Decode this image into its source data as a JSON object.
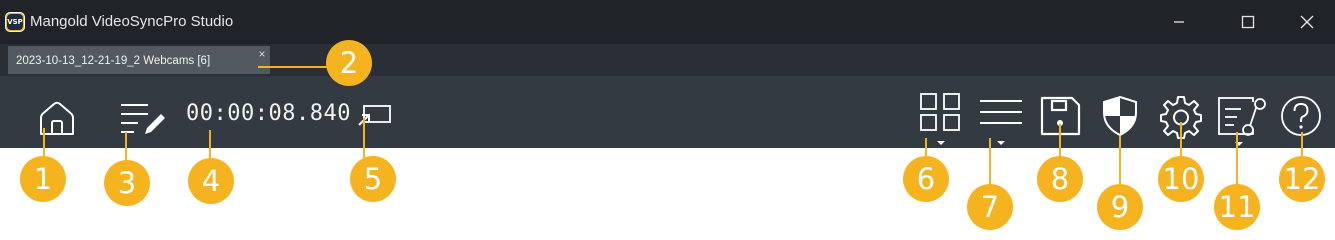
{
  "window": {
    "logo_text": "VSP",
    "title": "Mangold VideoSyncPro Studio"
  },
  "window_controls": [
    "minimize-icon",
    "maximize-icon",
    "close-icon"
  ],
  "tabs": [
    {
      "label": "2023-10-13_12-21-19_2 Webcams [6]",
      "close_label": "×"
    }
  ],
  "toolbar": {
    "timecode": "00:00:08.840",
    "left_icons": [
      "home-icon",
      "edit-notes-icon",
      "external-display-icon"
    ],
    "right_icons": [
      "layout-grid-icon",
      "list-menu-icon",
      "save-icon",
      "security-shield-icon",
      "settings-gear-icon",
      "workflow-list-icon",
      "help-icon"
    ]
  },
  "callouts": [
    "1",
    "2",
    "3",
    "4",
    "5",
    "6",
    "7",
    "8",
    "9",
    "10",
    "11",
    "12"
  ],
  "colors": {
    "titlebar": "#202428",
    "tabbar": "#2a2f35",
    "tab": "#525960",
    "toolbar": "#333a42",
    "callout": "#f5b41f"
  }
}
